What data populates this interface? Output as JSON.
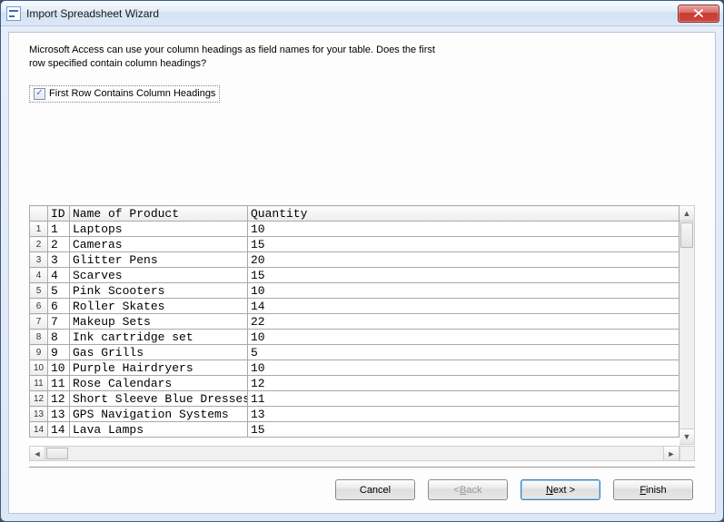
{
  "window": {
    "title": "Import Spreadsheet Wizard"
  },
  "instruction": {
    "line1": "Microsoft Access can use your column headings as field names for your table. Does the first",
    "line2": "row specified contain column headings?"
  },
  "checkbox": {
    "checked_glyph": "✓",
    "label_pre": "F",
    "label_ul": "i",
    "label_post": "rst Row Contains Column Headings"
  },
  "grid": {
    "headers": {
      "rownum": "",
      "id": "ID",
      "name": "Name of Product",
      "qty": "Quantity"
    },
    "rows": [
      {
        "n": "1",
        "id": "1",
        "name": "Laptops",
        "qty": "10"
      },
      {
        "n": "2",
        "id": "2",
        "name": "Cameras",
        "qty": "15"
      },
      {
        "n": "3",
        "id": "3",
        "name": "Glitter Pens",
        "qty": "20"
      },
      {
        "n": "4",
        "id": "4",
        "name": "Scarves",
        "qty": "15"
      },
      {
        "n": "5",
        "id": "5",
        "name": "Pink Scooters",
        "qty": "10"
      },
      {
        "n": "6",
        "id": "6",
        "name": "Roller Skates",
        "qty": "14"
      },
      {
        "n": "7",
        "id": "7",
        "name": "Makeup Sets",
        "qty": "22"
      },
      {
        "n": "8",
        "id": "8",
        "name": "Ink cartridge set",
        "qty": "10"
      },
      {
        "n": "9",
        "id": "9",
        "name": "Gas Grills",
        "qty": "5"
      },
      {
        "n": "10",
        "id": "10",
        "name": "Purple Hairdryers",
        "qty": "10"
      },
      {
        "n": "11",
        "id": "11",
        "name": "Rose Calendars",
        "qty": "12"
      },
      {
        "n": "12",
        "id": "12",
        "name": "Short Sleeve Blue Dresses",
        "qty": "11"
      },
      {
        "n": "13",
        "id": "13",
        "name": "GPS Navigation Systems",
        "qty": "13"
      },
      {
        "n": "14",
        "id": "14",
        "name": "Lava Lamps",
        "qty": "15"
      }
    ]
  },
  "buttons": {
    "cancel": "Cancel",
    "back_lt": "< ",
    "back_ul": "B",
    "back_post": "ack",
    "next_ul": "N",
    "next_post": "ext >",
    "finish_ul": "F",
    "finish_post": "inish"
  },
  "scroll": {
    "up": "▲",
    "down": "▼",
    "left": "◄",
    "right": "►"
  }
}
